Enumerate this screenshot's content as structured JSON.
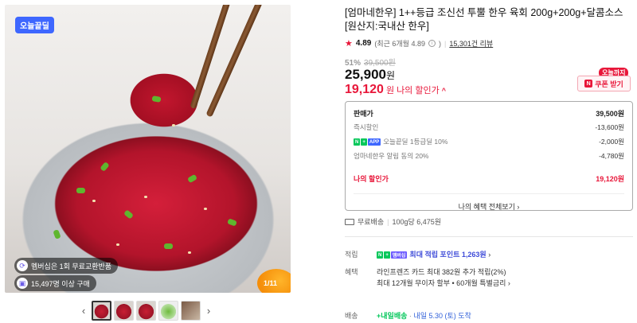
{
  "gallery": {
    "badge": "오늘끝딜",
    "overlay_1": "멤버십은 1회 무료교환반품",
    "overlay_2": "15,497명 이상 구매",
    "image_count": "1/11",
    "prev_arrow": "‹",
    "next_arrow": "›"
  },
  "product": {
    "title": "[엄마네한우] 1++등급 조신선 투뿔 한우 육회 200g+200g+달콤소스 [원산지:국내산 한우]",
    "rating": "4.89",
    "rating_note": "(최근 6개월 4.89",
    "rating_note_close": ")",
    "review_count": "15,301건 리뷰",
    "discount_pct": "51%",
    "original_price": "39,500원",
    "price": "25,900",
    "price_unit": "원",
    "my_price": "19,120",
    "my_price_unit": "원",
    "my_price_label": "나의 할인가",
    "caret": "^",
    "today_tag": "오늘까지",
    "coupon_n": "N",
    "coupon_label": "쿠폰 받기"
  },
  "price_box": {
    "sale_label": "판매가",
    "sale_value": "39,500원",
    "instant_label": "즉시할인",
    "instant_value": "-13,600원",
    "n_mark": "N",
    "plus_mark": "+",
    "app_mark": "APP",
    "deal_label": "오늘끝딜 1등급딜 10%",
    "deal_value": "-2,000원",
    "alarm_label": "엄마네한우 알림 동의 20%",
    "alarm_value": "-4,780원",
    "mine_label": "나의 할인가",
    "mine_value": "19,120원",
    "all_benefits": "나의 혜택 전체보기",
    "all_benefits_caret": "›"
  },
  "shipping": {
    "free_label": "무료배송",
    "per_unit": "100g당 6,475원"
  },
  "details": {
    "points_label": "적립",
    "points_n": "N",
    "points_plus": "+",
    "points_mem": "멤버십",
    "points_value": "최대 적립 포인트 1,263원",
    "points_caret": "›",
    "benefit_label": "혜택",
    "benefit_1": "라인프렌즈 카드 최대 382원 추가 적립(2%)",
    "benefit_2": "최대 12개월 무이자 할부 • 60개월 특별금리",
    "benefit_caret": "›",
    "delivery_label": "배송",
    "delivery_brand": "+내일배송",
    "delivery_dot": "·",
    "delivery_date": "내일 5.30 (토) 도착"
  },
  "colors": {
    "accent_red": "#e8173a",
    "naver_green": "#03c75a",
    "badge_blue": "#3e67ff"
  }
}
